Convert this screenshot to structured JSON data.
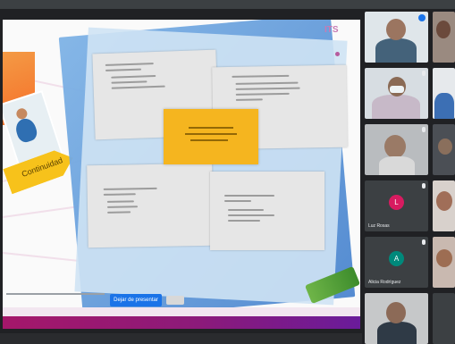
{
  "meeting": {
    "presentation": {
      "deco_mark": "ITS",
      "arrow_tag_text": "Continuidad",
      "blue_button_label": "Dejar de presentar"
    },
    "participants": [
      {
        "label": "",
        "color": "#1a73e8"
      },
      {
        "label": "",
        "color": "#3c4043"
      },
      {
        "label": "",
        "color": "#3c4043"
      },
      {
        "label": "Luz Rosas",
        "avatar_letter": "L",
        "avatar_color": "#d81b60"
      },
      {
        "label": "Alicia Rodríguez",
        "avatar_letter": "A",
        "avatar_color": "#00897b"
      },
      {
        "label": "",
        "color": "#3c4043"
      }
    ]
  }
}
